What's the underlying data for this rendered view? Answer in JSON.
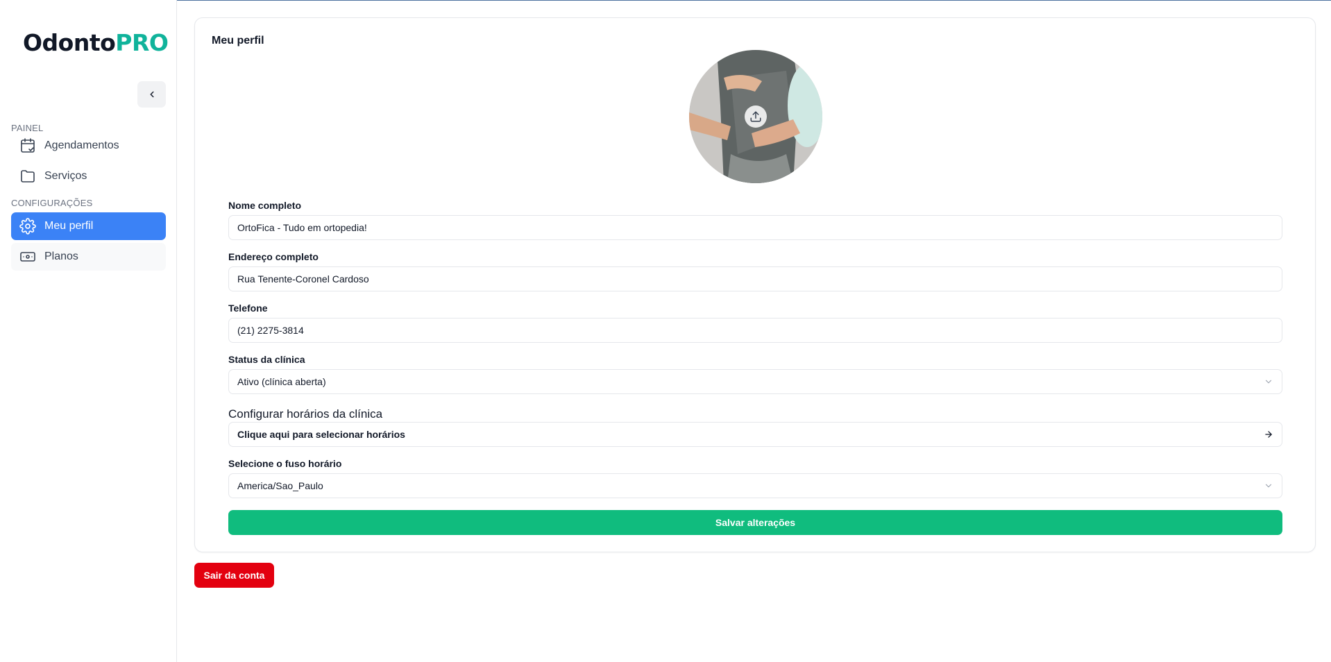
{
  "app": {
    "logo_part1": "Odonto",
    "logo_part2": "PRO",
    "brand_color": "#10b39b"
  },
  "sidebar": {
    "sections": [
      {
        "label": "PAINEL"
      },
      {
        "label": "CONFIGURAÇÕES"
      }
    ],
    "items": [
      {
        "label": "Agendamentos",
        "icon": "calendar-check-icon",
        "active": false
      },
      {
        "label": "Serviços",
        "icon": "folder-icon",
        "active": false
      },
      {
        "label": "Meu perfil",
        "icon": "gear-icon",
        "active": true
      },
      {
        "label": "Planos",
        "icon": "banknote-icon",
        "active": false
      }
    ],
    "active_color": "#3b82f6"
  },
  "profile": {
    "title": "Meu perfil",
    "avatar_icon": "upload-icon",
    "fields": {
      "name": {
        "label": "Nome completo",
        "value": "OrtoFica - Tudo em ortopedia!"
      },
      "address": {
        "label": "Endereço completo",
        "value": "Rua Tenente-Coronel Cardoso"
      },
      "phone": {
        "label": "Telefone",
        "value": "(21) 2275-3814"
      },
      "status": {
        "label": "Status da clínica",
        "value": "Ativo (clínica aberta)"
      },
      "timezone": {
        "label": "Selecione o fuso horário",
        "value": "America/Sao_Paulo"
      }
    },
    "hours": {
      "heading": "Configurar horários da clínica",
      "button_label": "Clique aqui para selecionar horários"
    },
    "save_label": "Salvar alterações",
    "save_color": "#10bc7e"
  },
  "logout": {
    "label": "Sair da conta",
    "color": "#e3000f"
  }
}
